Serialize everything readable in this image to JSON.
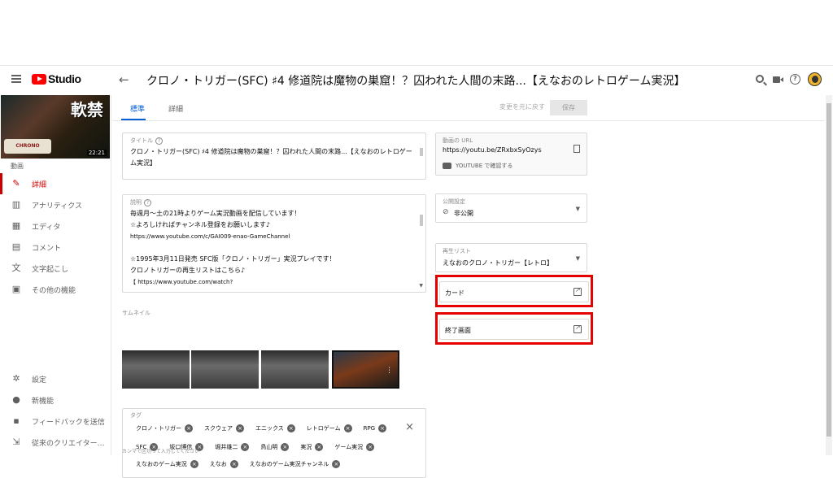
{
  "header": {
    "app_name": "Studio",
    "title": "クロノ・トリガー(SFC) ♯4 修道院は魔物の巣窟！？囚われた人間の末路...【えなおのレトロゲーム実況】"
  },
  "sidebar": {
    "thumbnail_duration": "22:21",
    "thumbnail_logo": "CHRONO TRIGGER",
    "thumbnail_kanji": "軟禁",
    "video_label": "動画",
    "items": [
      {
        "label": "詳細",
        "icon": "pencil-icon",
        "active": true
      },
      {
        "label": "アナリティクス",
        "icon": "analytics-icon",
        "active": false
      },
      {
        "label": "エディタ",
        "icon": "editor-icon",
        "active": false
      },
      {
        "label": "コメント",
        "icon": "comment-icon",
        "active": false
      },
      {
        "label": "文字起こし",
        "icon": "translate-icon",
        "active": false
      },
      {
        "label": "その他の機能",
        "icon": "other-features-icon",
        "active": false
      }
    ],
    "bottom_items": [
      {
        "label": "設定",
        "icon": "gear-icon"
      },
      {
        "label": "新機能",
        "icon": "alert-icon"
      },
      {
        "label": "フィードバックを送信",
        "icon": "feedback-icon"
      },
      {
        "label": "従来のクリエイター…",
        "icon": "classic-studio-icon"
      }
    ]
  },
  "tabs": [
    {
      "label": "標準",
      "active": true
    },
    {
      "label": "詳細",
      "active": false
    }
  ],
  "toolbar": {
    "undo_label": "変更を元に戻す",
    "save_label": "保存"
  },
  "form": {
    "title_label": "タイトル",
    "title_value_line1": "クロノ・トリガー(SFC) ♯4 修道院は魔物の巣窟！？囚われた人間の末路...【えなおのレトロゲー",
    "title_value_line2": "ム実況】",
    "desc_label": "説明",
    "desc_lines": [
      "毎週月～土の21時よりゲーム実況動画を配信しています！",
      "☆よろしければチャンネル登録をお願いします♪",
      "https://www.youtube.com/c/GAI009-enao-GameChannel",
      "",
      "☆1995年3月11日発売 SFC版「クロノ・トリガー」実況プレイです！",
      "クロノトリガーの再生リストはこちら♪",
      "【 https://www.youtube.com/watch?"
    ],
    "thumbnail_label": "サムネイル",
    "tags_label": "タグ",
    "tags_row1": [
      "クロノ・トリガー",
      "スクウェア",
      "エニックス",
      "レトロゲーム",
      "RPG"
    ],
    "tags_row2": [
      "SFC",
      "坂口博信",
      "堀井雄二",
      "鳥山明",
      "実況",
      "ゲーム実況"
    ],
    "tags_row3": [
      "えなおのゲーム実況",
      "えなお",
      "えなおのゲーム実況チャンネル"
    ],
    "tags_hint": "カンマで区切って入力してください"
  },
  "right_panel": {
    "url_label": "動画の URL",
    "url_value": "https://youtu.be/ZRxbxSyOzys",
    "youtube_check": "YOUTUBE で確認する",
    "visibility_label": "公開設定",
    "visibility_value": "非公開",
    "playlist_label": "再生リスト",
    "playlist_value": "えなおのクロノ・トリガー【レトロ】",
    "cards_label": "カード",
    "endscreen_label": "終了画面"
  },
  "colors": {
    "brand_red": "#ff0000",
    "active_blue": "#065fd4",
    "highlight_red": "#e60000"
  }
}
